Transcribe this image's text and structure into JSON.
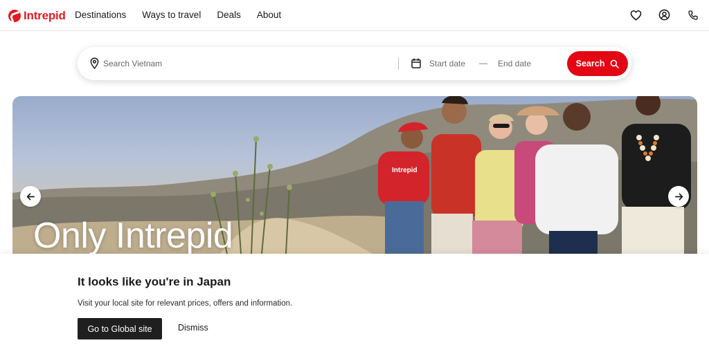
{
  "brand": {
    "name": "Intrepid",
    "color": "#e31b23"
  },
  "nav": {
    "items": [
      "Destinations",
      "Ways to travel",
      "Deals",
      "About"
    ]
  },
  "header_icons": [
    "heart-icon",
    "account-icon",
    "phone-icon"
  ],
  "search": {
    "placeholder": "Search Vietnam",
    "start_date_placeholder": "Start date",
    "separator": "—",
    "end_date_placeholder": "End date",
    "button_label": "Search",
    "button_color": "#e30613"
  },
  "hero": {
    "title": "Only Intrepid",
    "shirt_text": "Intrepid"
  },
  "locale_banner": {
    "title": "It looks like you're in Japan",
    "message": "Visit your local site for relevant prices, offers and information.",
    "primary_button": "Go to Global site",
    "secondary_button": "Dismiss"
  }
}
